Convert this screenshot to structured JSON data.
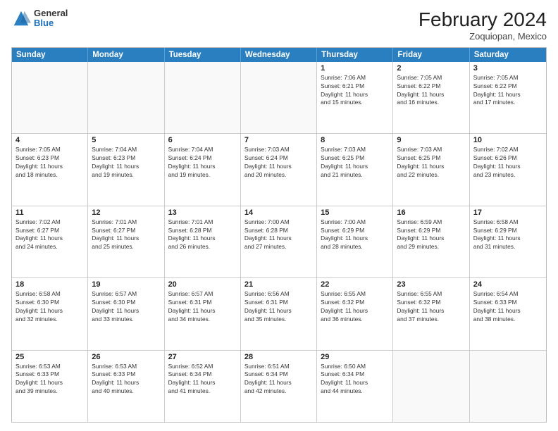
{
  "header": {
    "logo": {
      "general": "General",
      "blue": "Blue"
    },
    "title": "February 2024",
    "location": "Zoquiopan, Mexico"
  },
  "days_of_week": [
    "Sunday",
    "Monday",
    "Tuesday",
    "Wednesday",
    "Thursday",
    "Friday",
    "Saturday"
  ],
  "weeks": [
    [
      {
        "day": "",
        "info": ""
      },
      {
        "day": "",
        "info": ""
      },
      {
        "day": "",
        "info": ""
      },
      {
        "day": "",
        "info": ""
      },
      {
        "day": "1",
        "info": "Sunrise: 7:06 AM\nSunset: 6:21 PM\nDaylight: 11 hours\nand 15 minutes."
      },
      {
        "day": "2",
        "info": "Sunrise: 7:05 AM\nSunset: 6:22 PM\nDaylight: 11 hours\nand 16 minutes."
      },
      {
        "day": "3",
        "info": "Sunrise: 7:05 AM\nSunset: 6:22 PM\nDaylight: 11 hours\nand 17 minutes."
      }
    ],
    [
      {
        "day": "4",
        "info": "Sunrise: 7:05 AM\nSunset: 6:23 PM\nDaylight: 11 hours\nand 18 minutes."
      },
      {
        "day": "5",
        "info": "Sunrise: 7:04 AM\nSunset: 6:23 PM\nDaylight: 11 hours\nand 19 minutes."
      },
      {
        "day": "6",
        "info": "Sunrise: 7:04 AM\nSunset: 6:24 PM\nDaylight: 11 hours\nand 19 minutes."
      },
      {
        "day": "7",
        "info": "Sunrise: 7:03 AM\nSunset: 6:24 PM\nDaylight: 11 hours\nand 20 minutes."
      },
      {
        "day": "8",
        "info": "Sunrise: 7:03 AM\nSunset: 6:25 PM\nDaylight: 11 hours\nand 21 minutes."
      },
      {
        "day": "9",
        "info": "Sunrise: 7:03 AM\nSunset: 6:25 PM\nDaylight: 11 hours\nand 22 minutes."
      },
      {
        "day": "10",
        "info": "Sunrise: 7:02 AM\nSunset: 6:26 PM\nDaylight: 11 hours\nand 23 minutes."
      }
    ],
    [
      {
        "day": "11",
        "info": "Sunrise: 7:02 AM\nSunset: 6:27 PM\nDaylight: 11 hours\nand 24 minutes."
      },
      {
        "day": "12",
        "info": "Sunrise: 7:01 AM\nSunset: 6:27 PM\nDaylight: 11 hours\nand 25 minutes."
      },
      {
        "day": "13",
        "info": "Sunrise: 7:01 AM\nSunset: 6:28 PM\nDaylight: 11 hours\nand 26 minutes."
      },
      {
        "day": "14",
        "info": "Sunrise: 7:00 AM\nSunset: 6:28 PM\nDaylight: 11 hours\nand 27 minutes."
      },
      {
        "day": "15",
        "info": "Sunrise: 7:00 AM\nSunset: 6:29 PM\nDaylight: 11 hours\nand 28 minutes."
      },
      {
        "day": "16",
        "info": "Sunrise: 6:59 AM\nSunset: 6:29 PM\nDaylight: 11 hours\nand 29 minutes."
      },
      {
        "day": "17",
        "info": "Sunrise: 6:58 AM\nSunset: 6:29 PM\nDaylight: 11 hours\nand 31 minutes."
      }
    ],
    [
      {
        "day": "18",
        "info": "Sunrise: 6:58 AM\nSunset: 6:30 PM\nDaylight: 11 hours\nand 32 minutes."
      },
      {
        "day": "19",
        "info": "Sunrise: 6:57 AM\nSunset: 6:30 PM\nDaylight: 11 hours\nand 33 minutes."
      },
      {
        "day": "20",
        "info": "Sunrise: 6:57 AM\nSunset: 6:31 PM\nDaylight: 11 hours\nand 34 minutes."
      },
      {
        "day": "21",
        "info": "Sunrise: 6:56 AM\nSunset: 6:31 PM\nDaylight: 11 hours\nand 35 minutes."
      },
      {
        "day": "22",
        "info": "Sunrise: 6:55 AM\nSunset: 6:32 PM\nDaylight: 11 hours\nand 36 minutes."
      },
      {
        "day": "23",
        "info": "Sunrise: 6:55 AM\nSunset: 6:32 PM\nDaylight: 11 hours\nand 37 minutes."
      },
      {
        "day": "24",
        "info": "Sunrise: 6:54 AM\nSunset: 6:33 PM\nDaylight: 11 hours\nand 38 minutes."
      }
    ],
    [
      {
        "day": "25",
        "info": "Sunrise: 6:53 AM\nSunset: 6:33 PM\nDaylight: 11 hours\nand 39 minutes."
      },
      {
        "day": "26",
        "info": "Sunrise: 6:53 AM\nSunset: 6:33 PM\nDaylight: 11 hours\nand 40 minutes."
      },
      {
        "day": "27",
        "info": "Sunrise: 6:52 AM\nSunset: 6:34 PM\nDaylight: 11 hours\nand 41 minutes."
      },
      {
        "day": "28",
        "info": "Sunrise: 6:51 AM\nSunset: 6:34 PM\nDaylight: 11 hours\nand 42 minutes."
      },
      {
        "day": "29",
        "info": "Sunrise: 6:50 AM\nSunset: 6:34 PM\nDaylight: 11 hours\nand 44 minutes."
      },
      {
        "day": "",
        "info": ""
      },
      {
        "day": "",
        "info": ""
      }
    ]
  ]
}
